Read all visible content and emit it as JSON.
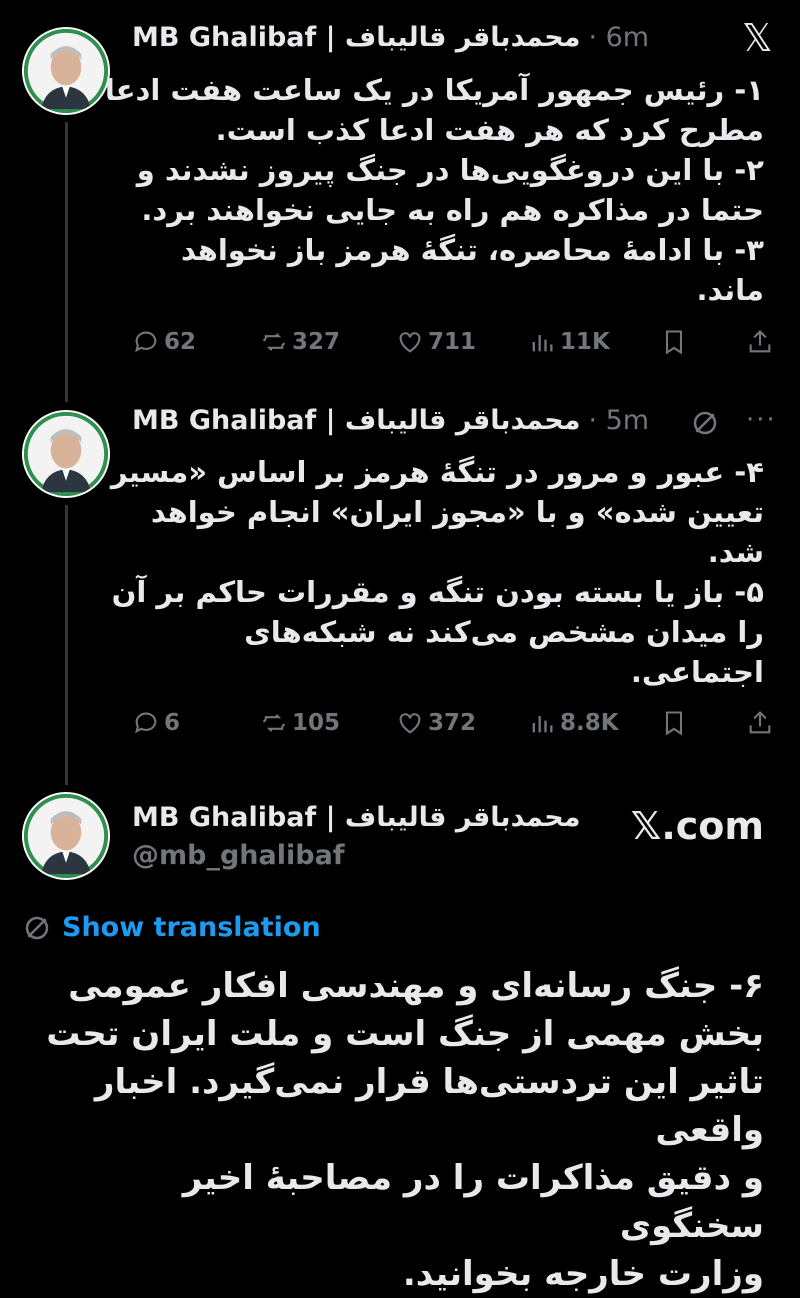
{
  "tweets": [
    {
      "display_name": "MB Ghalibaf | محمدباقر قالیباف",
      "time": "· 6m",
      "lines": [
        "۱- رئیس جمهور آمریکا در یک ساعت هفت ادعا",
        "مطرح کرد که هر هفت ادعا کذب است.",
        "۲- با این دروغگویی‌ها در جنگ پیروز نشدند و",
        "حتما در مذاکره هم راه به جایی نخواهند برد.",
        "۳- با ادامۀ محاصره، تنگۀ هرمز باز نخواهد",
        "ماند."
      ],
      "replies": "62",
      "reposts": "327",
      "likes": "711",
      "views": "11K"
    },
    {
      "display_name": "MB Ghalibaf | محمدباقر قالیباف",
      "time": "· 5m",
      "lines": [
        "۴- عبور و مرور در تنگۀ هرمز بر اساس «مسیر",
        "تعیین شده» و با «مجوز ایران» انجام خواهد",
        "شد.",
        "۵- باز یا بسته بودن تنگه و مقررات حاکم بر آن",
        "را میدان مشخص می‌کند نه شبکه‌های",
        "اجتماعی."
      ],
      "replies": "6",
      "reposts": "105",
      "likes": "372",
      "views": "8.8K"
    }
  ],
  "card": {
    "display_name": "MB Ghalibaf | محمدباقر قالیباف",
    "handle": "@mb_ghalibaf",
    "site": "𝕏.com",
    "show_translation": "Show translation",
    "lines": [
      "۶- جنگ رسانه‌ای و مهندسی افکار عمومی",
      "بخش مهمی از جنگ است و ملت ایران تحت",
      "تاثیر این تردستی‌ها قرار نمی‌گیرد. اخبار واقعی",
      "و دقیق مذاکرات را در مصاحبۀ اخیر سخنگوی",
      "وزارت خارجه بخوانید."
    ]
  },
  "icons": {
    "logo": "x-logo-icon",
    "translate": "no-translate-icon",
    "more": "more-icon"
  }
}
